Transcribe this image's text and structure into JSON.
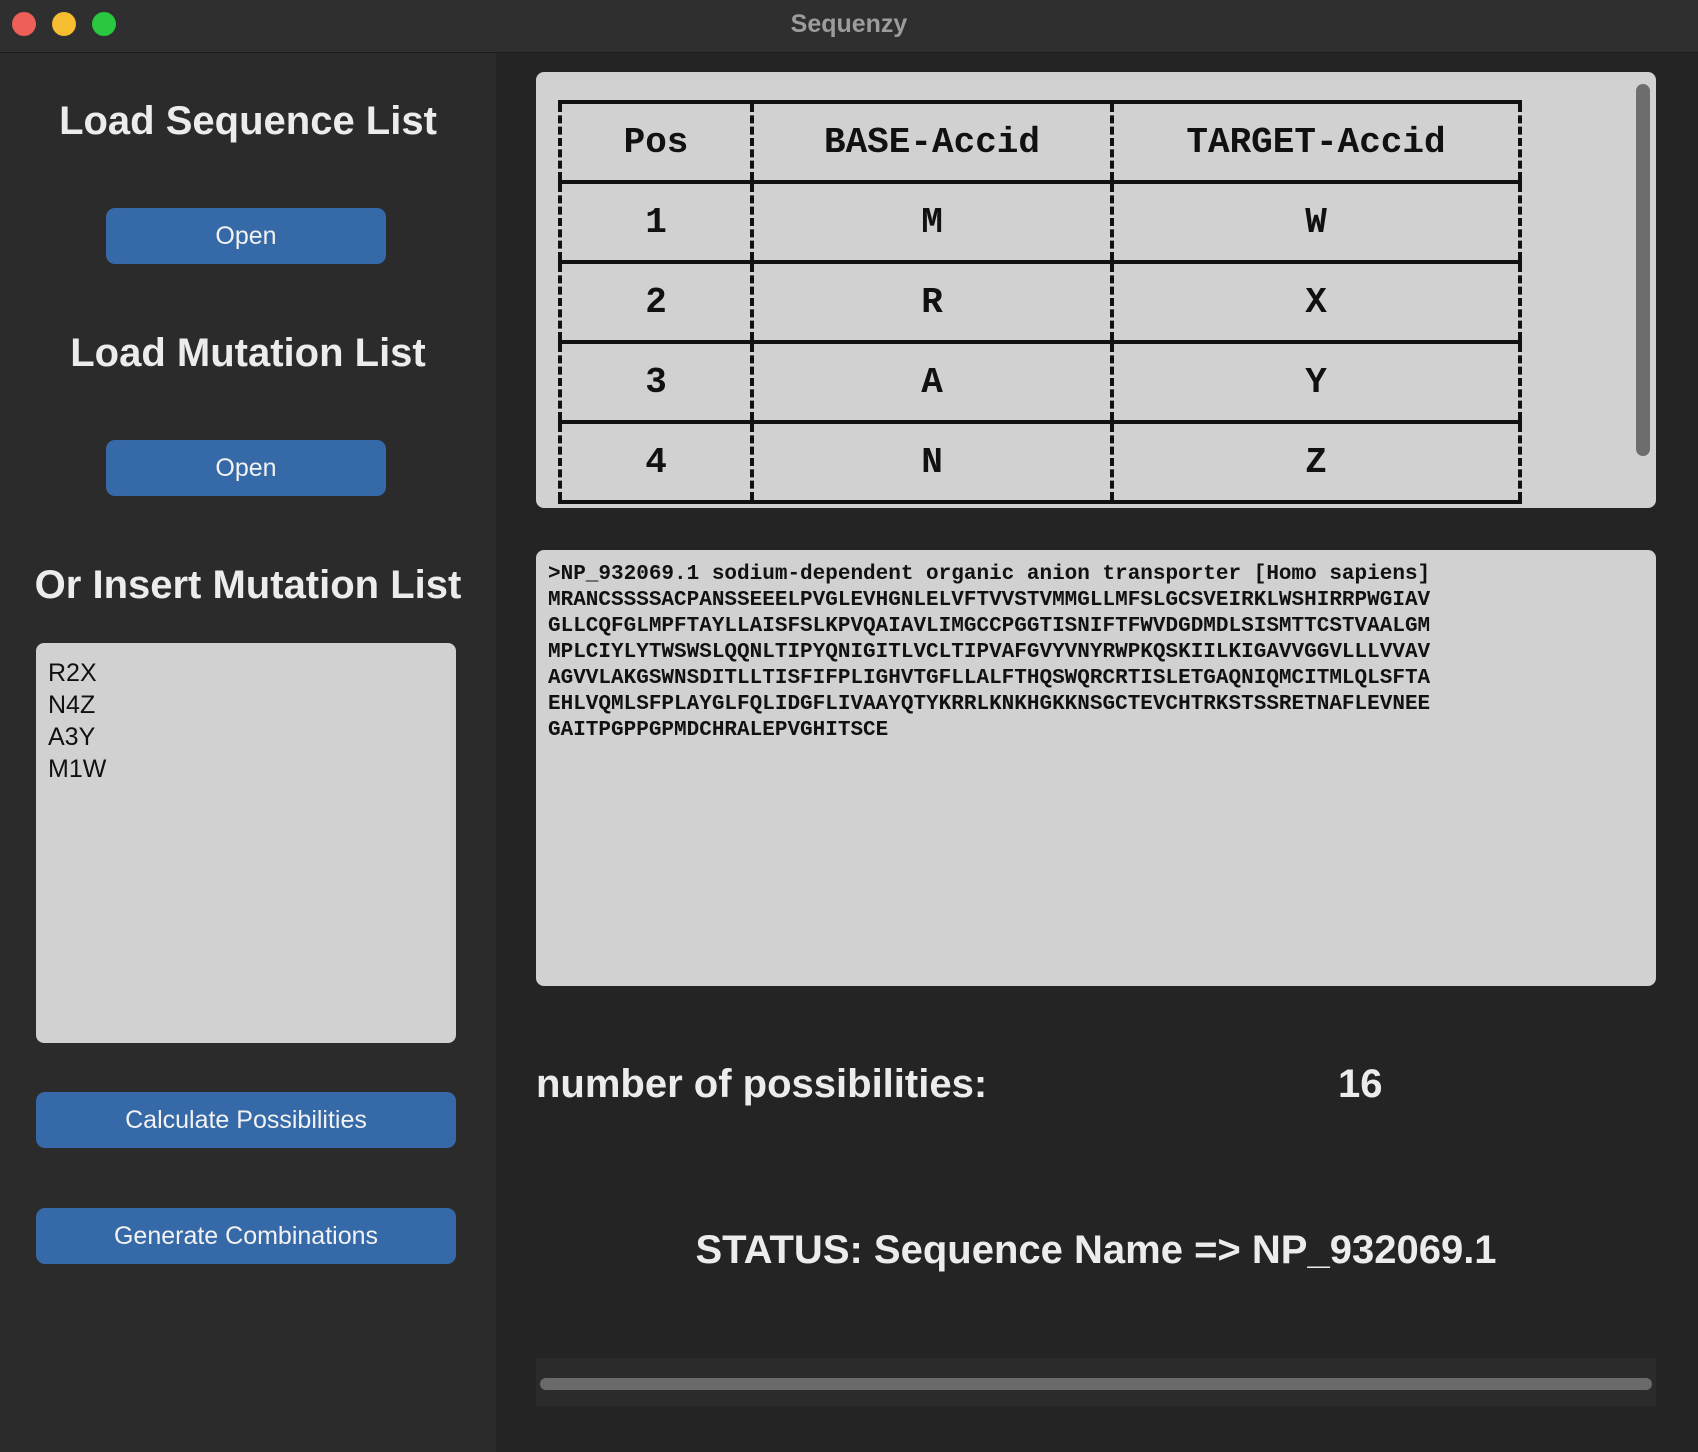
{
  "window": {
    "title": "Sequenzy"
  },
  "sidebar": {
    "load_sequence_heading": "Load Sequence List",
    "load_sequence_button": "Open",
    "load_mutation_heading": "Load Mutation List",
    "load_mutation_button": "Open",
    "insert_mutation_heading": "Or Insert Mutation List",
    "mutation_lines": [
      "R2X",
      "N4Z",
      "A3Y",
      "M1W"
    ],
    "calculate_button": "Calculate Possibilities",
    "generate_button": "Generate Combinations"
  },
  "mutation_table": {
    "headers": [
      "Pos",
      "BASE-Accid",
      "TARGET-Accid"
    ],
    "rows": [
      [
        "1",
        "M",
        "W"
      ],
      [
        "2",
        "R",
        "X"
      ],
      [
        "3",
        "A",
        "Y"
      ],
      [
        "4",
        "N",
        "Z"
      ]
    ]
  },
  "sequence": {
    "lines": [
      ">NP_932069.1 sodium-dependent organic anion transporter [Homo sapiens]",
      "MRANCSSSSACPANSSEEELPVGLEVHGNLELVFTVVSTVMMGLLMFSLGCSVEIRKLWSHIRRPWGIAV",
      "GLLCQFGLMPFTAYLLAISFSLKPVQAIAVLIMGCCPGGTISNIFTFWVDGDMDLSISMTTCSTVAALGM",
      "MPLCIYLYTWSWSLQQNLTIPYQNIGITLVCLTIPVAFGVYVNYRWPKQSKIILKIGAVVGGVLLLVVAV",
      "AGVVLAKGSWNSDITLLTISFIFPLIGHVTGFLLALFTHQSWQRCRTISLETGAQNIQMCITMLQLSFTA",
      "EHLVQMLSFPLAYGLFQLIDGFLIVAAYQTYKRRLKNKHGKKNSGCTEVCHTRKSTSSRETNAFLEVNEE",
      "GAITPGPPGPMDCHRALEPVGHITSCE"
    ]
  },
  "possibilities": {
    "label": "number of possibilities:",
    "value": "16"
  },
  "status": {
    "text": "STATUS: Sequence Name => NP_932069.1"
  }
}
